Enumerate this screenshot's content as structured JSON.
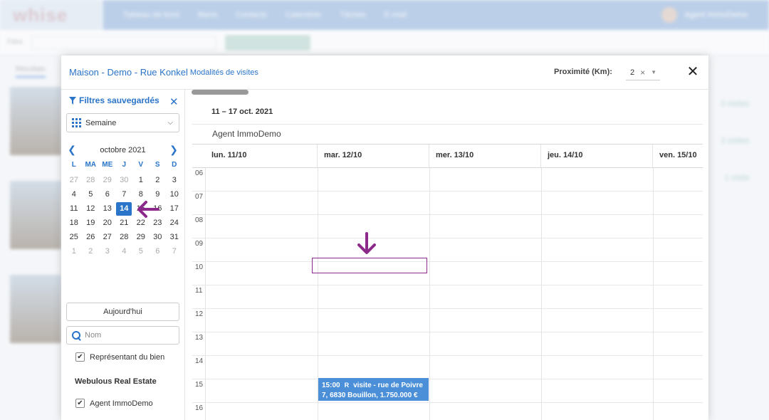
{
  "background": {
    "logo": "whise",
    "nav": [
      "Tableau de bord",
      "Biens",
      "Contacts",
      "Calendrier",
      "Tâches",
      "E-mail"
    ],
    "user": "Agent ImmoDemo",
    "toolbar_left": "Filtre",
    "tab": "Résultats",
    "right_counts": [
      "3 visites",
      "3 visites",
      "1 visite"
    ]
  },
  "modal": {
    "title": "Maison - Demo - Rue Konkel",
    "subtitle": "Modalités de visites",
    "proximity_label": "Proximité (Km):",
    "proximity_value": "2",
    "close_symbol": "✕"
  },
  "sidebar": {
    "filters_title": "Filtres sauvegardés",
    "filters_close": "✕",
    "view_select": "Semaine",
    "month_label": "octobre 2021",
    "weekdays": [
      "L",
      "MA",
      "ME",
      "J",
      "V",
      "S",
      "D"
    ],
    "weeks": [
      [
        "27",
        "28",
        "29",
        "30",
        "1",
        "2",
        "3"
      ],
      [
        "4",
        "5",
        "6",
        "7",
        "8",
        "9",
        "10"
      ],
      [
        "11",
        "12",
        "13",
        "14",
        "15",
        "16",
        "17"
      ],
      [
        "18",
        "19",
        "20",
        "21",
        "22",
        "23",
        "24"
      ],
      [
        "25",
        "26",
        "27",
        "28",
        "29",
        "30",
        "31"
      ],
      [
        "1",
        "2",
        "3",
        "4",
        "5",
        "6",
        "7"
      ]
    ],
    "selected_day": "14",
    "today_button": "Aujourd'hui",
    "name_placeholder": "Nom",
    "check_representant": "Représentant du bien",
    "group_label": "Webulous Real Estate",
    "check_agent": "Agent ImmoDemo"
  },
  "calendar": {
    "week_range": "11 – 17 oct. 2021",
    "agent": "Agent ImmoDemo",
    "days": [
      "lun. 11/10",
      "mar. 12/10",
      "mer. 13/10",
      "jeu. 14/10",
      "ven. 15/10"
    ],
    "hours": [
      "06",
      "07",
      "08",
      "09",
      "10",
      "11",
      "12",
      "13",
      "14",
      "15",
      "16"
    ],
    "event": {
      "time": "15:00",
      "badge": "R",
      "title": "visite - rue de Poivre",
      "line2": "7, 6830 Bouillon, 1.750.000 €"
    }
  },
  "annotation_color": "#8b2a8a",
  "accent_color": "#2a74c9"
}
